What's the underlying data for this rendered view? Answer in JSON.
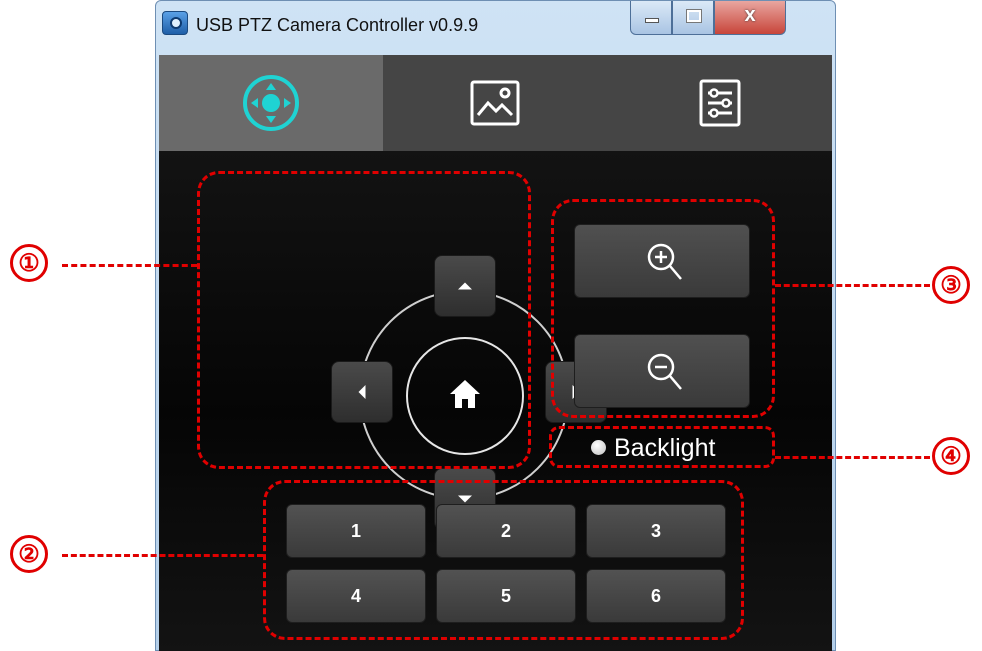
{
  "window": {
    "title": "USB PTZ Camera Controller v0.9.9",
    "controls": {
      "minimize": "minimize",
      "maximize": "maximize",
      "close_glyph": "x"
    }
  },
  "tabs": [
    {
      "icon": "ptz-joystick-icon",
      "active": true
    },
    {
      "icon": "image-icon",
      "active": false
    },
    {
      "icon": "settings-sliders-icon",
      "active": false
    }
  ],
  "ptz": {
    "up_icon": "arrow-up-icon",
    "down_icon": "arrow-down-icon",
    "left_icon": "arrow-left-icon",
    "right_icon": "arrow-right-icon",
    "home_icon": "home-icon"
  },
  "zoom": {
    "in_icon": "zoom-in-icon",
    "out_icon": "zoom-out-icon"
  },
  "backlight": {
    "label": "Backlight",
    "checked": false
  },
  "presets": [
    "1",
    "2",
    "3",
    "4",
    "5",
    "6"
  ],
  "annotations": [
    "①",
    "②",
    "③",
    "④"
  ],
  "colors": {
    "accent": "#1fd3d3",
    "annotation": "#e00000",
    "background": "#0a0a0a",
    "tab_active": "#6a6a6a",
    "tab_bar": "#454545"
  }
}
